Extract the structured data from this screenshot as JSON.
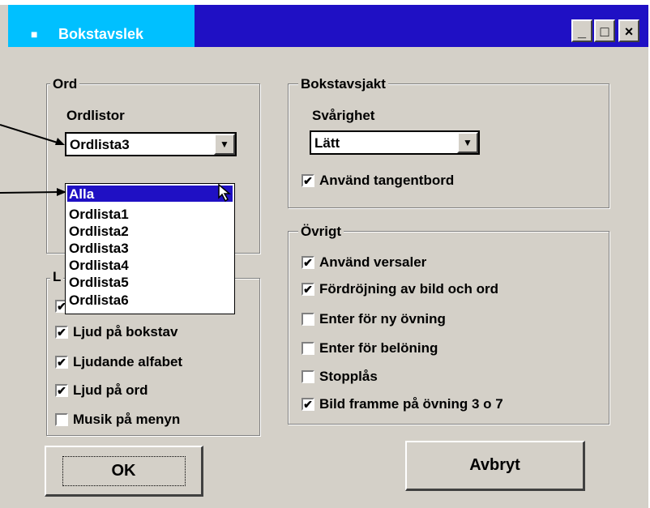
{
  "window": {
    "title": "Bokstavslek",
    "minimize_symbol": "_",
    "maximize_symbol": "□",
    "close_symbol": "×"
  },
  "ord_group": {
    "label": "Ord",
    "ordlistor_label": "Ordlistor",
    "ordlistor_value": "Ordlista3",
    "dropdown_items": [
      "Alla",
      "Ordlista1",
      "Ordlista2",
      "Ordlista3",
      "Ordlista4",
      "Ordlista5",
      "Ordlista6"
    ]
  },
  "ljud_group": {
    "label": "L",
    "checkboxes": [
      {
        "label": "Ljud på bokstav",
        "checked": true
      },
      {
        "label": "Ljudande alfabet",
        "checked": true
      },
      {
        "label": "Ljud på ord",
        "checked": true
      },
      {
        "label": "Musik på menyn",
        "checked": false
      }
    ]
  },
  "bokstavsjakt_group": {
    "label": "Bokstavsjakt",
    "svarighet_label": "Svårighet",
    "svarighet_value": "Lätt",
    "keyboard_label": "Använd tangentbord",
    "keyboard_checked": true
  },
  "ovrigt_group": {
    "label": "Övrigt",
    "checkboxes": [
      {
        "label": "Använd versaler",
        "checked": true
      },
      {
        "label": "Fördröjning av bild och ord",
        "checked": true
      },
      {
        "label": "Enter för ny övning",
        "checked": false
      },
      {
        "label": "Enter för belöning",
        "checked": false
      },
      {
        "label": "Stopplås",
        "checked": false
      },
      {
        "label": "Bild framme på övning 3 o 7",
        "checked": true
      }
    ]
  },
  "buttons": {
    "ok_label": "OK",
    "cancel_label": "Avbryt"
  },
  "check_mark": "✔",
  "combo_arrow": "▼"
}
